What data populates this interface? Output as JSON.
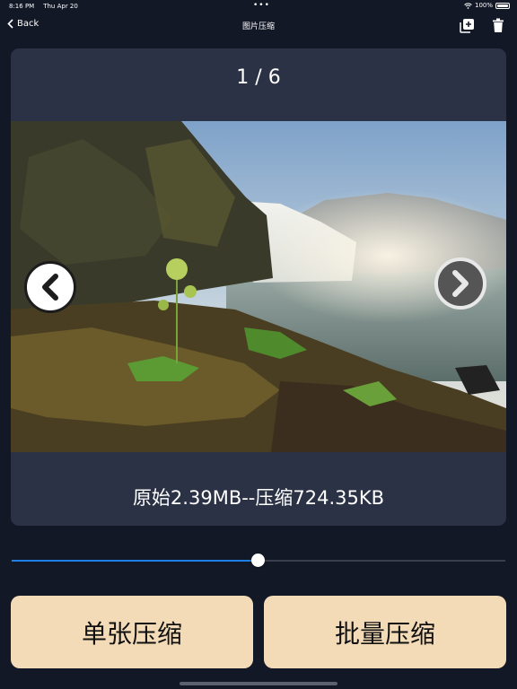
{
  "status_bar": {
    "time": "8:16 PM",
    "date": "Thu Apr 20",
    "battery": "100%"
  },
  "nav": {
    "back_label": "Back",
    "title": "图片压缩"
  },
  "viewer": {
    "counter": "1 / 6",
    "size_info": "原始2.39MB--压缩724.35KB"
  },
  "quality_slider": {
    "value": 0.5
  },
  "buttons": {
    "single": "单张压缩",
    "batch": "批量压缩"
  },
  "colors": {
    "background": "#131827",
    "card": "#2b3246",
    "accent": "#1e7fe6",
    "button": "#f3dbb8"
  },
  "icons": [
    "chevron-left-icon",
    "wifi-icon",
    "battery-icon",
    "add-photo-icon",
    "trash-icon",
    "arrow-left-icon",
    "arrow-right-icon"
  ]
}
